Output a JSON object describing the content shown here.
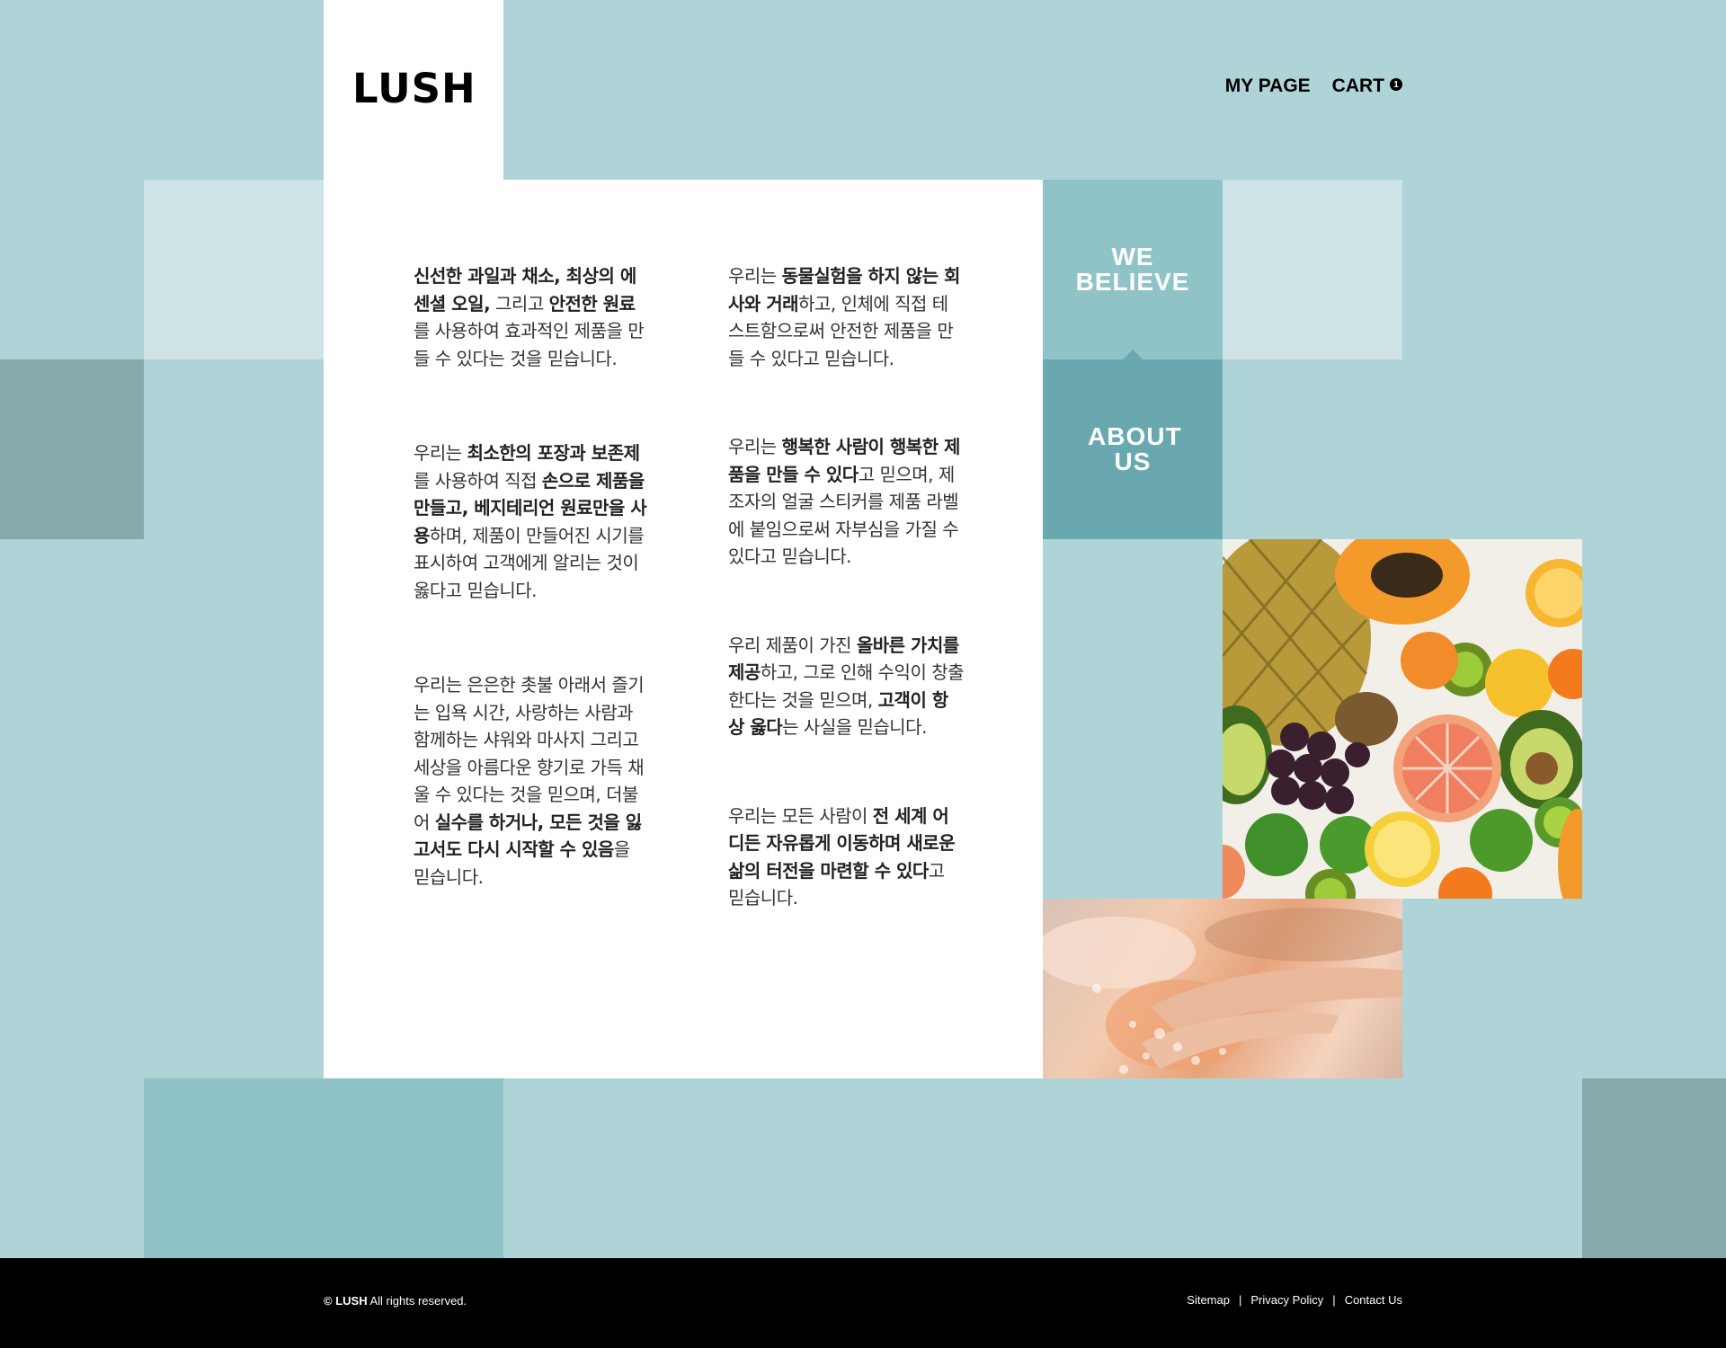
{
  "header": {
    "logo": "LUSH",
    "nav": {
      "my_page": "MY PAGE",
      "cart": "CART",
      "cart_count": "1"
    }
  },
  "side_nav": {
    "tabs": [
      {
        "label": "WE BELIEVE",
        "active": true
      },
      {
        "label": "ABOUT US",
        "active": false
      }
    ]
  },
  "content": {
    "left_column": [
      [
        {
          "text": "신선한 과일과 채소, 최상의 에센셜 오일,",
          "bold": true
        },
        {
          "text": " 그리고 ",
          "bold": false
        },
        {
          "text": "안전한 원료",
          "bold": true
        },
        {
          "text": "를 사용하여 효과적인 제품을 만들 수 있다는 것을 믿습니다.",
          "bold": false
        }
      ],
      [
        {
          "text": "우리는 ",
          "bold": false
        },
        {
          "text": "최소한의 포장과 보존제",
          "bold": true
        },
        {
          "text": "를 사용하여 직접 ",
          "bold": false
        },
        {
          "text": "손으로 제품을 만들고, 베지테리언 원료만을 사용",
          "bold": true
        },
        {
          "text": "하며, 제품이 만들어진 시기를 표시하여 고객에게 알리는 것이 옳다고 믿습니다.",
          "bold": false
        }
      ],
      [
        {
          "text": "우리는 은은한 촛불 아래서 즐기는 입욕 시간, 사랑하는 사람과 함께하는 샤워와 마사지 그리고 세상을 아름다운 향기로 가득 채울 수 있다는 것을 믿으며, 더불어 ",
          "bold": false
        },
        {
          "text": "실수를 하거나, 모든 것을 잃고서도 다시 시작할 수 있음",
          "bold": true
        },
        {
          "text": "을 믿습니다.",
          "bold": false
        }
      ]
    ],
    "right_column": [
      [
        {
          "text": "우리는 ",
          "bold": false
        },
        {
          "text": "동물실험을 하지 않는 회사와 거래",
          "bold": true
        },
        {
          "text": "하고, 인체에 직접 테스트함으로써 안전한 제품을 만들 수 있다고 믿습니다.",
          "bold": false
        }
      ],
      [
        {
          "text": "우리는 ",
          "bold": false
        },
        {
          "text": "행복한 사람이 행복한 제품을 만들 수 있다",
          "bold": true
        },
        {
          "text": "고 믿으며, 제조자의 얼굴 스티커를 제품 라벨에 붙임으로써 자부심을 가질 수 있다고 믿습니다.",
          "bold": false
        }
      ],
      [
        {
          "text": "우리 제품이 가진 ",
          "bold": false
        },
        {
          "text": "올바른 가치를 제공",
          "bold": true
        },
        {
          "text": "하고, 그로 인해 수익이 창출한다는 것을 믿으며, ",
          "bold": false
        },
        {
          "text": "고객이 항상 옳다",
          "bold": true
        },
        {
          "text": "는 사실을 믿습니다.",
          "bold": false
        }
      ],
      [
        {
          "text": "우리는 모든 사람이 ",
          "bold": false
        },
        {
          "text": "전 세계 어디든 자유롭게 이동하며 새로운 삶의 터전을 마련할 수 있다",
          "bold": true
        },
        {
          "text": "고 믿습니다.",
          "bold": false
        }
      ]
    ]
  },
  "images": {
    "fruit": "fruit-photo",
    "soap": "bath-foam-photo"
  },
  "footer": {
    "copyright_brand": "© LUSH",
    "copyright_text": " All rights reserved.",
    "links": [
      "Sitemap",
      "Privacy Policy",
      "Contact Us"
    ]
  },
  "colors": {
    "background": "#afd4d7",
    "light_tile": "#cde3e5",
    "mid_tile": "#8fc3c8",
    "dark_tile": "#87a9aa",
    "teal_tab": "#6aa8b0",
    "panel": "#ffffff",
    "footer": "#000000"
  }
}
